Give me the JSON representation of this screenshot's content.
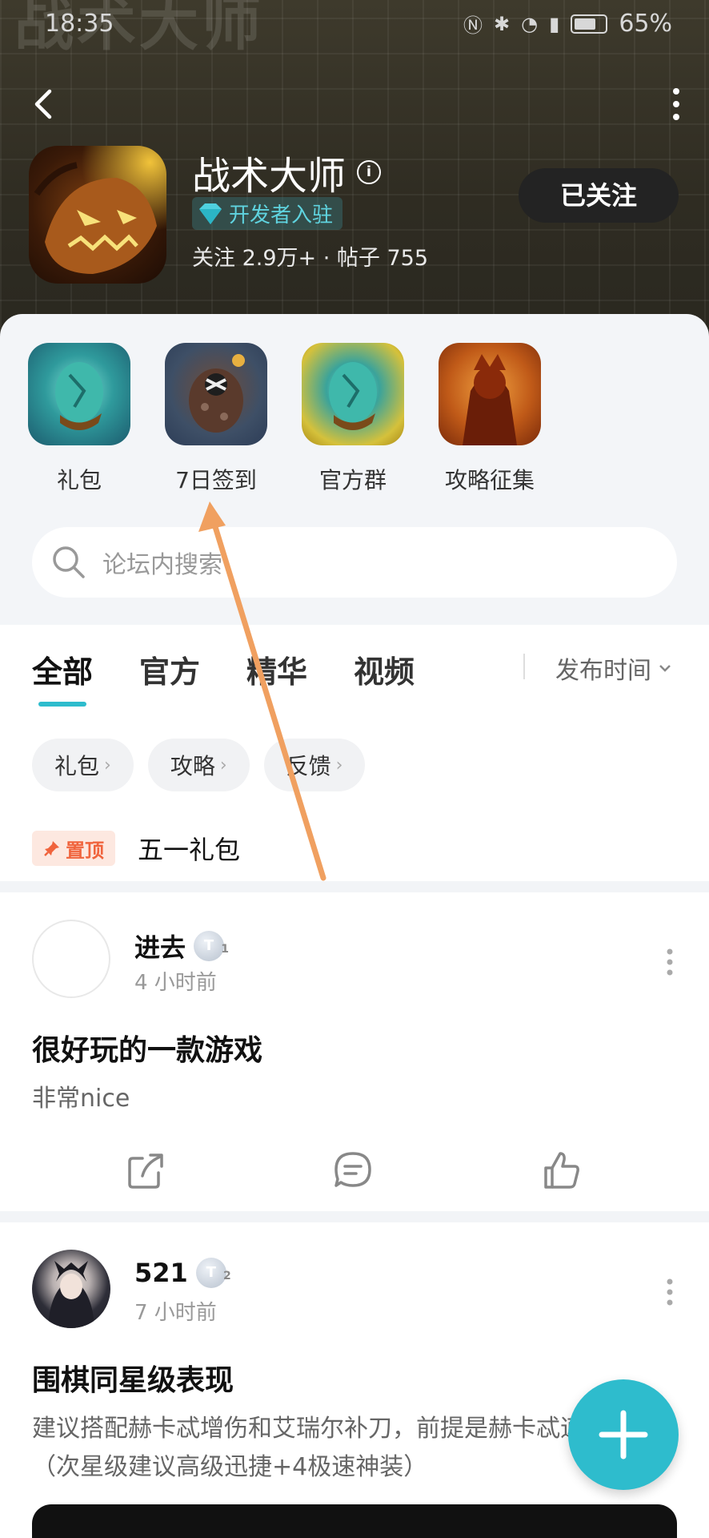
{
  "status": {
    "time": "18:35",
    "battery": "65%"
  },
  "header": {
    "watermark": "战术大师",
    "title": "战术大师",
    "developer_badge": "开发者入驻",
    "stats": "关注 2.9万+ · 帖子 755",
    "follow_label": "已关注"
  },
  "quick_actions": [
    {
      "label": "礼包",
      "icon": "gift-egg-icon"
    },
    {
      "label": "7日签到",
      "icon": "checkin-egg-icon"
    },
    {
      "label": "官方群",
      "icon": "group-egg-icon"
    },
    {
      "label": "攻略征集",
      "icon": "guide-character-icon"
    }
  ],
  "search": {
    "placeholder": "论坛内搜索"
  },
  "tabs": [
    "全部",
    "官方",
    "精华",
    "视频"
  ],
  "sort_label": "发布时间",
  "chips": [
    "礼包",
    "攻略",
    "反馈"
  ],
  "pinned": {
    "badge": "置顶",
    "title": "五一礼包"
  },
  "posts": [
    {
      "user": "进去",
      "level": "T",
      "level_num": "1",
      "time": "4 小时前",
      "title": "很好玩的一款游戏",
      "body": "非常nice"
    },
    {
      "user": "521",
      "level": "T",
      "level_num": "2",
      "time": "7 小时前",
      "title": "围棋同星级表现",
      "body": "建议搭配赫卡忒增伤和艾瑞尔补刀，前提是赫卡忒速度要快（次星级建议高级迅捷+4极速神装）"
    }
  ],
  "colors": {
    "accent": "#2ebccd",
    "pin": "#f0643d",
    "annotation_arrow": "#f0a060"
  }
}
